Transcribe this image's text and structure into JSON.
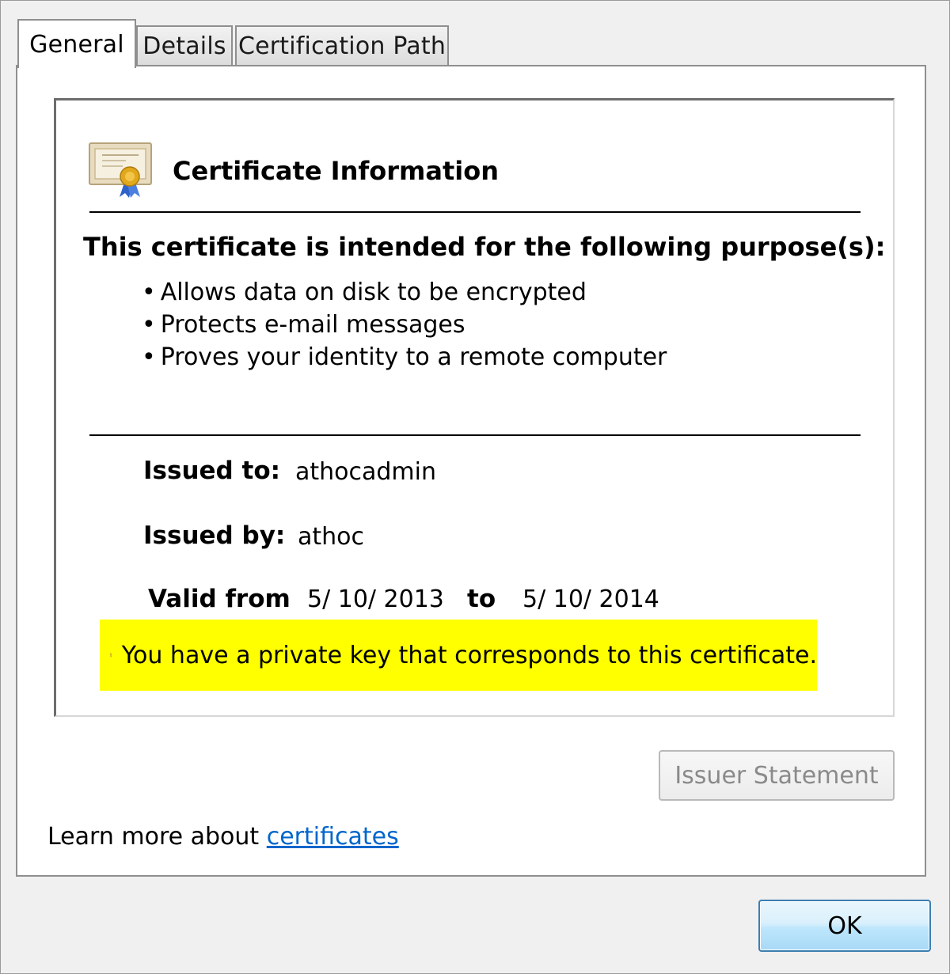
{
  "tabs": [
    {
      "label": "General",
      "active": true
    },
    {
      "label": "Details",
      "active": false
    },
    {
      "label": "Certification Path",
      "active": false
    }
  ],
  "certificate": {
    "title": "Certificate Information",
    "purpose_heading": "This certificate is intended for the following purpose(s):",
    "purposes": [
      "Allows data on disk to be encrypted",
      "Protects e-mail messages",
      "Proves your identity to a remote computer"
    ],
    "issued_to_label": "Issued to:",
    "issued_to": "athocadmin",
    "issued_by_label": "Issued by:",
    "issued_by": "athoc",
    "valid_from_label": "Valid from",
    "valid_from": "5/ 10/ 2013",
    "valid_to_label": "to",
    "valid_to": "5/ 10/ 2014",
    "private_key_note": "You have a private key that corresponds to this certificate."
  },
  "buttons": {
    "issuer_statement": "Issuer Statement",
    "ok": "OK"
  },
  "learn_more": {
    "text": "Learn more about ",
    "link": "certificates"
  },
  "colors": {
    "highlight": "#ffff00",
    "link": "#0066cc",
    "ok_border": "#3c7fb1"
  },
  "icons": [
    "certificate-icon",
    "key-icon"
  ]
}
